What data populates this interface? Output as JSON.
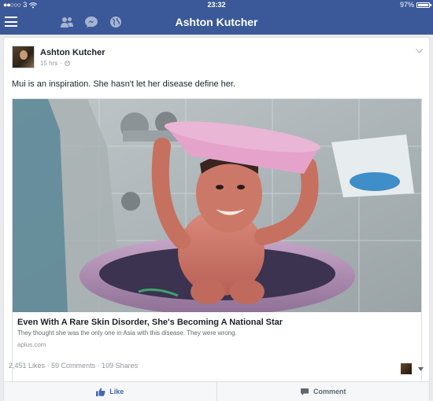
{
  "status_bar": {
    "signal_dots": "●●○○○",
    "carrier": "3",
    "time": "23:32",
    "battery": "97%"
  },
  "nav": {
    "title": "Ashton Kutcher",
    "icons": [
      "friends-icon",
      "messenger-icon",
      "globe-icon"
    ]
  },
  "post": {
    "author": "Ashton Kutcher",
    "timestamp": "15 hrs",
    "privacy_icon": "globe-icon",
    "text": "Mui is an inspiration. She hasn't let her disease define her.",
    "link": {
      "title": "Even With A Rare Skin Disorder, She's Becoming A National Star",
      "description": "They thought she was the only one in Asia with this disease. They were wrong.",
      "domain": "aplus.com"
    },
    "stats": {
      "likes": "2,451 Likes",
      "sep1": " · ",
      "comments": "59 Comments",
      "sep2": " · ",
      "shares": "109 Shares"
    },
    "actions": {
      "like": "Like",
      "comment": "Comment"
    }
  },
  "colors": {
    "brand": "#3b5998",
    "link_blue": "#4267b2"
  }
}
